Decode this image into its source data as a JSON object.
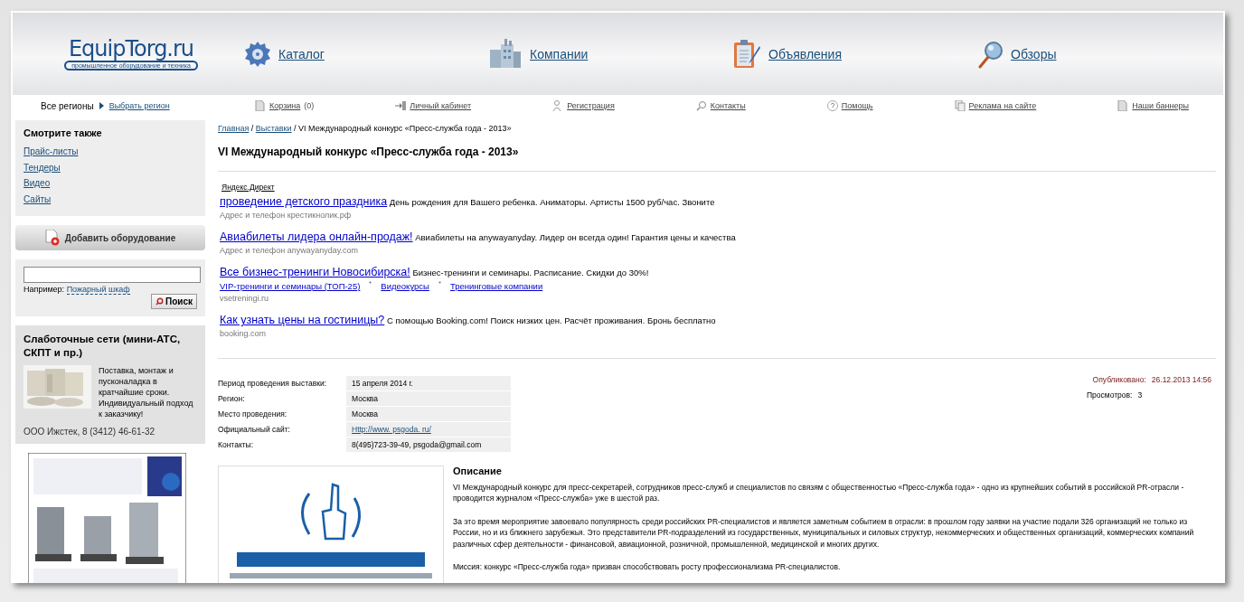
{
  "header": {
    "logo": {
      "name": "EquipTorg.ru",
      "tagline": "промышленное оборудование и техника"
    },
    "nav": [
      {
        "label": "Каталог"
      },
      {
        "label": "Компании"
      },
      {
        "label": "Объявления"
      },
      {
        "label": "Обзоры"
      }
    ]
  },
  "toolbar": {
    "region": {
      "label": "Все регионы",
      "link": "Выбрать регион"
    },
    "links": [
      {
        "label": "Корзина",
        "count": "(0)"
      },
      {
        "label": "Личный кабинет"
      },
      {
        "label": "Регистрация"
      },
      {
        "label": "Контакты"
      },
      {
        "label": "Помощь"
      },
      {
        "label": "Реклама на сайте"
      },
      {
        "label": "Наши баннеры"
      }
    ]
  },
  "sidebar": {
    "see_also": {
      "title": "Смотрите также",
      "links": [
        "Прайс-листы",
        "Тендеры",
        "Видео",
        "Сайты"
      ]
    },
    "add_button": "Добавить оборудование",
    "search": {
      "example_label": "Например:",
      "example_link": "Пожарный шкаф",
      "button": "Поиск"
    },
    "promo": {
      "title": "Слаботочные сети (мини-АТС, СКПТ и пр.)",
      "text": "Поставка, монтаж и пусконаладка в кратчайшие сроки. Индивидуальный подход к заказчику!",
      "contact": "ООО Ижстек, 8 (3412) 46-61-32"
    }
  },
  "content": {
    "breadcrumb_separator": "/",
    "breadcrumbs": [
      {
        "label": "Главная",
        "link": true
      },
      {
        "label": "Выставки",
        "link": true
      },
      {
        "label": "VI Международный конкурс «Пресс-служба года - 2013»",
        "link": false
      }
    ],
    "title": "VI Международный конкурс «Пресс-служба года - 2013»",
    "ads": {
      "label": "Яндекс.Директ",
      "items": [
        {
          "title": "проведение детского праздника",
          "text": "День рождения для Вашего ребенка. Аниматоры. Артисты 1500 руб/час. Звоните",
          "address": "Адрес и телефон",
          "domain": "крестикнолик.рф"
        },
        {
          "title": "Авиабилеты лидера онлайн-продаж!",
          "text": "Авиабилеты на anywayanyday. Лидер он всегда один! Гарантия цены и качества",
          "address": "Адрес и телефон",
          "domain": "anywayanyday.com"
        },
        {
          "title": "Все бизнес-тренинги Новосибирска!",
          "text": "Бизнес-тренинги и семинары. Расписание. Скидки до 30%!",
          "sitelinks": [
            "VIP-тренинги и семинары (ТОП-25)",
            "Видеокурсы",
            "Тренинговые компании"
          ],
          "domain": "vsetreningi.ru"
        },
        {
          "title": "Как узнать цены на гостиницы?",
          "text": "С помощью Booking.com! Поиск низких цен. Расчёт проживания. Бронь бесплатно",
          "domain": "booking.com"
        }
      ]
    },
    "details": [
      {
        "label": "Период проведения выставки:",
        "value": "15 апреля 2014 г.",
        "kind": "text"
      },
      {
        "label": "Регион:",
        "value": "Москва",
        "kind": "text"
      },
      {
        "label": "Место проведения:",
        "value": "Москва",
        "kind": "text"
      },
      {
        "label": "Официальный сайт:",
        "value": "Http://www. psgoda. ru/",
        "kind": "link"
      },
      {
        "label": "Контакты:",
        "value": "8(495)723-39-49, psgoda@gmail.com",
        "kind": "text"
      }
    ],
    "meta": {
      "published": {
        "label": "Опубликовано:",
        "value": "26.12.2013 14:56"
      },
      "views": {
        "label": "Просмотров:",
        "value": "3"
      }
    },
    "description": {
      "title": "Описание",
      "paragraphs": [
        "VI Международный конкурс для пресс-секретарей, сотрудников пресс-служб и специалистов по связям с общественностью «Пресс-служба года» - одно из крупнейших событий в российской PR-отрасли - проводится журналом «Пресс-служба» уже в шестой раз.",
        "За это время мероприятие завоевало популярность среди российских PR-специалистов и является заметным событием в отрасли: в прошлом году заявки на участие подали 326 организаций не только из России, но и из ближнего зарубежья. Это представители PR-подразделений из государственных, муниципальных и силовых структур, некоммерческих и общественных организаций, коммерческих компаний различных сфер деятельности - финансовой, авиационной, розничной, промышленной, медицинской и многих других.",
        "Миссия: конкурс «Пресс-служба года» призван способствовать росту профессионализма PR-специалистов."
      ]
    }
  }
}
